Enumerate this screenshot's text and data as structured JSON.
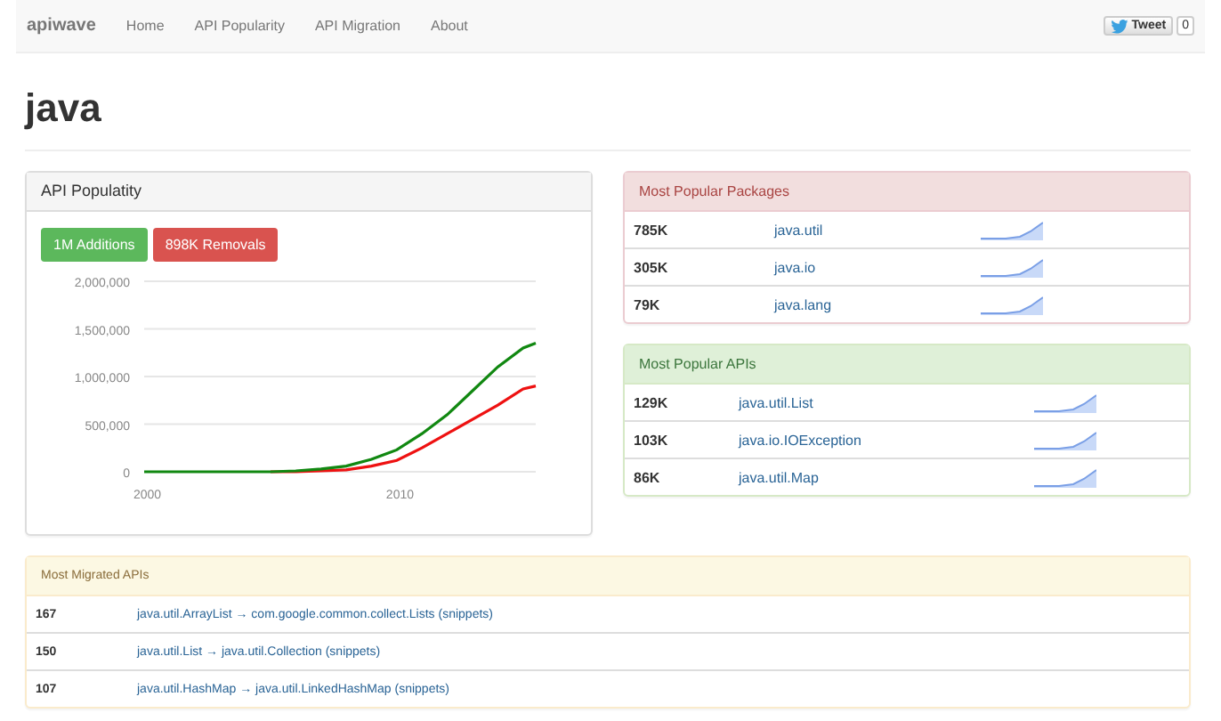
{
  "navbar": {
    "brand": "apiwave",
    "links": [
      {
        "label": "Home",
        "selected": false
      },
      {
        "label": "API Popularity",
        "selected": false
      },
      {
        "label": "API Migration",
        "selected": false
      },
      {
        "label": "About",
        "selected": false
      }
    ],
    "tweet": {
      "label": "Tweet",
      "count": "0"
    }
  },
  "heading": "java",
  "popularity": {
    "title": "API Populatity",
    "additions": "1M Additions",
    "removals": "898K Removals",
    "chart_data": {
      "type": "line",
      "x": [
        2000,
        2001,
        2002,
        2003,
        2004,
        2005,
        2006,
        2007,
        2008,
        2009,
        2010,
        2011,
        2012,
        2013,
        2014,
        2015,
        2015.5
      ],
      "xlim": [
        2000,
        2015.5
      ],
      "ylim": [
        0,
        2000000
      ],
      "xticks": [
        2000,
        2010
      ],
      "grid": true,
      "yticks": [
        {
          "value": 0,
          "label": "0"
        },
        {
          "value": 500000,
          "label": "500,000"
        },
        {
          "value": 1000000,
          "label": "1,000,000"
        },
        {
          "value": 1500000,
          "label": "1,500,000"
        },
        {
          "value": 2000000,
          "label": "2,000,000"
        }
      ],
      "series": [
        {
          "color": "#118811",
          "values": [
            0,
            0,
            0,
            0,
            0,
            0,
            10000,
            30000,
            60000,
            130000,
            230000,
            400000,
            600000,
            850000,
            1100000,
            1300000,
            1350000
          ]
        },
        {
          "color": "#ee1111",
          "values": [
            null,
            null,
            null,
            null,
            null,
            0,
            0,
            10000,
            20000,
            60000,
            120000,
            250000,
            400000,
            550000,
            700000,
            870000,
            900000
          ]
        }
      ]
    }
  },
  "packages": {
    "title": "Most Popular Packages",
    "rows": [
      {
        "count": "785K",
        "name": "java.util"
      },
      {
        "count": "305K",
        "name": "java.io"
      },
      {
        "count": "79K",
        "name": "java.lang"
      }
    ]
  },
  "apis": {
    "title": "Most Popular APIs",
    "rows": [
      {
        "count": "129K",
        "name": "java.util.List"
      },
      {
        "count": "103K",
        "name": "java.io.IOException"
      },
      {
        "count": "86K",
        "name": "java.util.Map"
      }
    ]
  },
  "migrated": {
    "title": "Most Migrated APIs",
    "rows": [
      {
        "count": "167",
        "migration": "java.util.ArrayList → com.google.common.collect.Lists",
        "snippets": "(snippets)"
      },
      {
        "count": "150",
        "migration": "java.util.List → java.util.Collection",
        "snippets": "(snippets)"
      },
      {
        "count": "107",
        "migration": "java.util.HashMap → java.util.LinkedHashMap",
        "snippets": "(snippets)"
      }
    ]
  }
}
